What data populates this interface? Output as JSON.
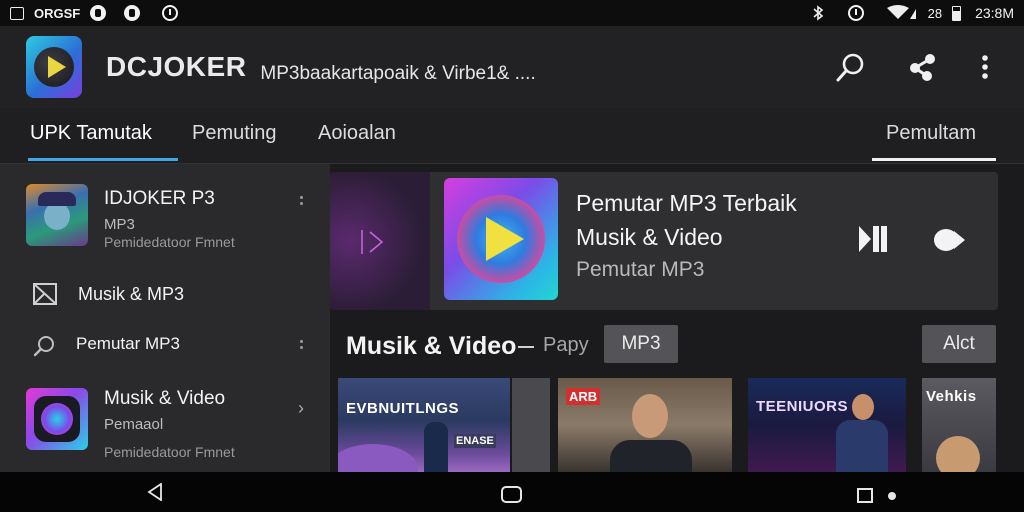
{
  "status_bar": {
    "left_text": "ORGSF",
    "time": "23:8M",
    "battery_text": "28"
  },
  "app": {
    "title": "DCJOKER",
    "subtitle": "MP3baakartapoaik & Virbe1& ...."
  },
  "tabs": [
    {
      "label": "UPK Tamutak",
      "active": true
    },
    {
      "label": "Pemuting",
      "active": false
    },
    {
      "label": "Aoioalan",
      "active": false
    },
    {
      "label": "Pemultam",
      "active": false
    }
  ],
  "sidebar": {
    "items": [
      {
        "title": "IDJOKER P3",
        "sub": "MP3",
        "sub2": "Pemidedatoor Fmnet",
        "icon": "joker-avatar"
      },
      {
        "title": "Musik & MP3",
        "icon": "media-icon"
      },
      {
        "title": "Pemutar MP3",
        "icon": "search-icon"
      },
      {
        "title": "Musik & Video",
        "sub": "Pemaaol",
        "sub2": "Pemidedatoor Fmnet",
        "icon": "music-app-icon"
      }
    ]
  },
  "now_playing": {
    "title_line1": "Pemutar MP3 Terbaik",
    "title_line2": "Musik & Video",
    "subtitle": "Pemutar MP3"
  },
  "section": {
    "title": "Musik & Video",
    "filter_label": "Papy",
    "chip_mp3": "MP3",
    "chip_all": "Alct"
  },
  "thumbnails": [
    {
      "caption": "EVBNUITLNGS",
      "sub_caption": "ENASE"
    },
    {
      "caption": "",
      "badge": "ARB"
    },
    {
      "caption": "TEENIUORS"
    },
    {
      "caption": "Vehkis"
    }
  ],
  "colors": {
    "accent": "#3fa7e8",
    "background": "#1b1b1d",
    "appbar": "#222225",
    "sidebar": "#2a2a2c",
    "card": "#2f2f32"
  }
}
